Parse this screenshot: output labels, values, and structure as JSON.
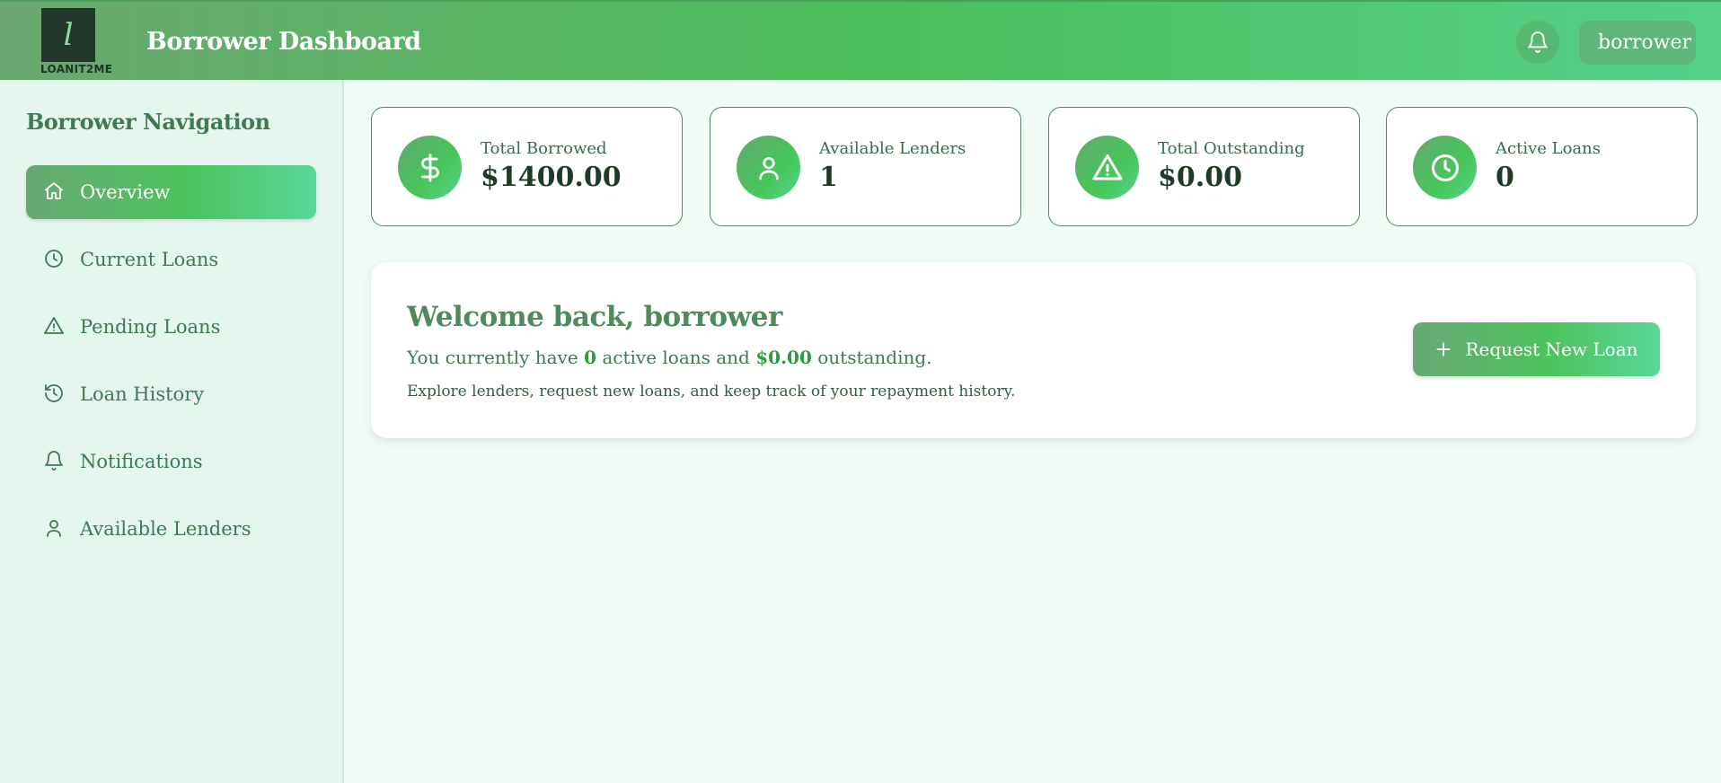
{
  "header": {
    "logo_letter": "l",
    "logo_text": "LOANIT2ME",
    "title": "Borrower Dashboard",
    "user_label": "borrower"
  },
  "sidebar": {
    "title": "Borrower Navigation",
    "items": [
      {
        "label": "Overview",
        "icon": "home-icon",
        "active": true
      },
      {
        "label": "Current Loans",
        "icon": "clock-icon",
        "active": false
      },
      {
        "label": "Pending Loans",
        "icon": "warning-icon",
        "active": false
      },
      {
        "label": "Loan History",
        "icon": "history-icon",
        "active": false
      },
      {
        "label": "Notifications",
        "icon": "bell-icon",
        "active": false
      },
      {
        "label": "Available Lenders",
        "icon": "user-icon",
        "active": false
      }
    ]
  },
  "stats": [
    {
      "label": "Total Borrowed",
      "value": "$1400.00",
      "icon": "dollar-icon"
    },
    {
      "label": "Available Lenders",
      "value": "1",
      "icon": "user-icon"
    },
    {
      "label": "Total Outstanding",
      "value": "$0.00",
      "icon": "warning-icon"
    },
    {
      "label": "Active Loans",
      "value": "0",
      "icon": "clock-icon"
    }
  ],
  "welcome": {
    "title": "Welcome back, borrower",
    "line_prefix": "You currently have ",
    "active_count": "0",
    "line_mid": " active loans and ",
    "outstanding": "$0.00",
    "line_suffix": " outstanding.",
    "subtitle": "Explore lenders, request new loans, and keep track of your repayment history.",
    "button_label": "Request New Loan"
  },
  "colors": {
    "accent": "#4bbf5a",
    "text_green": "#3f7a52",
    "highlight": "#2e9a45"
  }
}
